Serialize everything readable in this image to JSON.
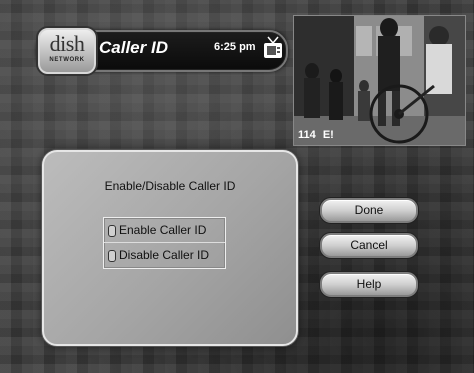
{
  "header": {
    "logo_word": "dish",
    "logo_sub": "NETWORK",
    "title": "Caller ID",
    "time": "6:25 pm"
  },
  "video": {
    "channel_number": "114",
    "channel_name": "E!"
  },
  "dialog": {
    "title": "Enable/Disable Caller ID",
    "options": [
      {
        "label": "Enable Caller ID"
      },
      {
        "label": "Disable Caller ID"
      }
    ]
  },
  "buttons": {
    "done": "Done",
    "cancel": "Cancel",
    "help": "Help"
  },
  "icons": {
    "logo": "dish-network-logo",
    "tv": "tv-icon"
  }
}
